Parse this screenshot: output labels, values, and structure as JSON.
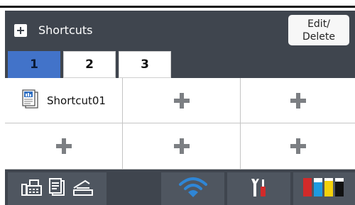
{
  "header": {
    "title": "Shortcuts",
    "edit_button_line1": "Edit/",
    "edit_button_line2": "Delete"
  },
  "tabs": [
    {
      "label": "1",
      "active": true
    },
    {
      "label": "2",
      "active": false
    },
    {
      "label": "3",
      "active": false
    }
  ],
  "grid": {
    "cells": [
      {
        "type": "shortcut",
        "label": "Shortcut01",
        "icon": "scan-to-document-icon"
      },
      {
        "type": "add",
        "icon": "plus-icon"
      },
      {
        "type": "add",
        "icon": "plus-icon"
      },
      {
        "type": "add",
        "icon": "plus-icon"
      },
      {
        "type": "add",
        "icon": "plus-icon"
      },
      {
        "type": "add",
        "icon": "plus-icon"
      }
    ]
  },
  "bottom_bar": {
    "buttons": [
      {
        "name": "fax-copy-scan-button",
        "icons": [
          "fax-icon",
          "copy-icon",
          "scan-icon"
        ]
      },
      {
        "name": "wifi-button",
        "icons": [
          "wifi-icon"
        ]
      },
      {
        "name": "settings-button",
        "icons": [
          "tools-icon"
        ]
      },
      {
        "name": "ink-button",
        "icons": [
          "ink-cartridge-icon"
        ]
      }
    ]
  },
  "colors": {
    "panel_background": "#3f454e",
    "active_tab": "#4273c9",
    "wifi": "#2f86d6",
    "ink_red": "#d22a2a",
    "ink_cyan": "#1e9be0",
    "ink_yellow": "#f4d10b",
    "ink_black": "#111111"
  }
}
